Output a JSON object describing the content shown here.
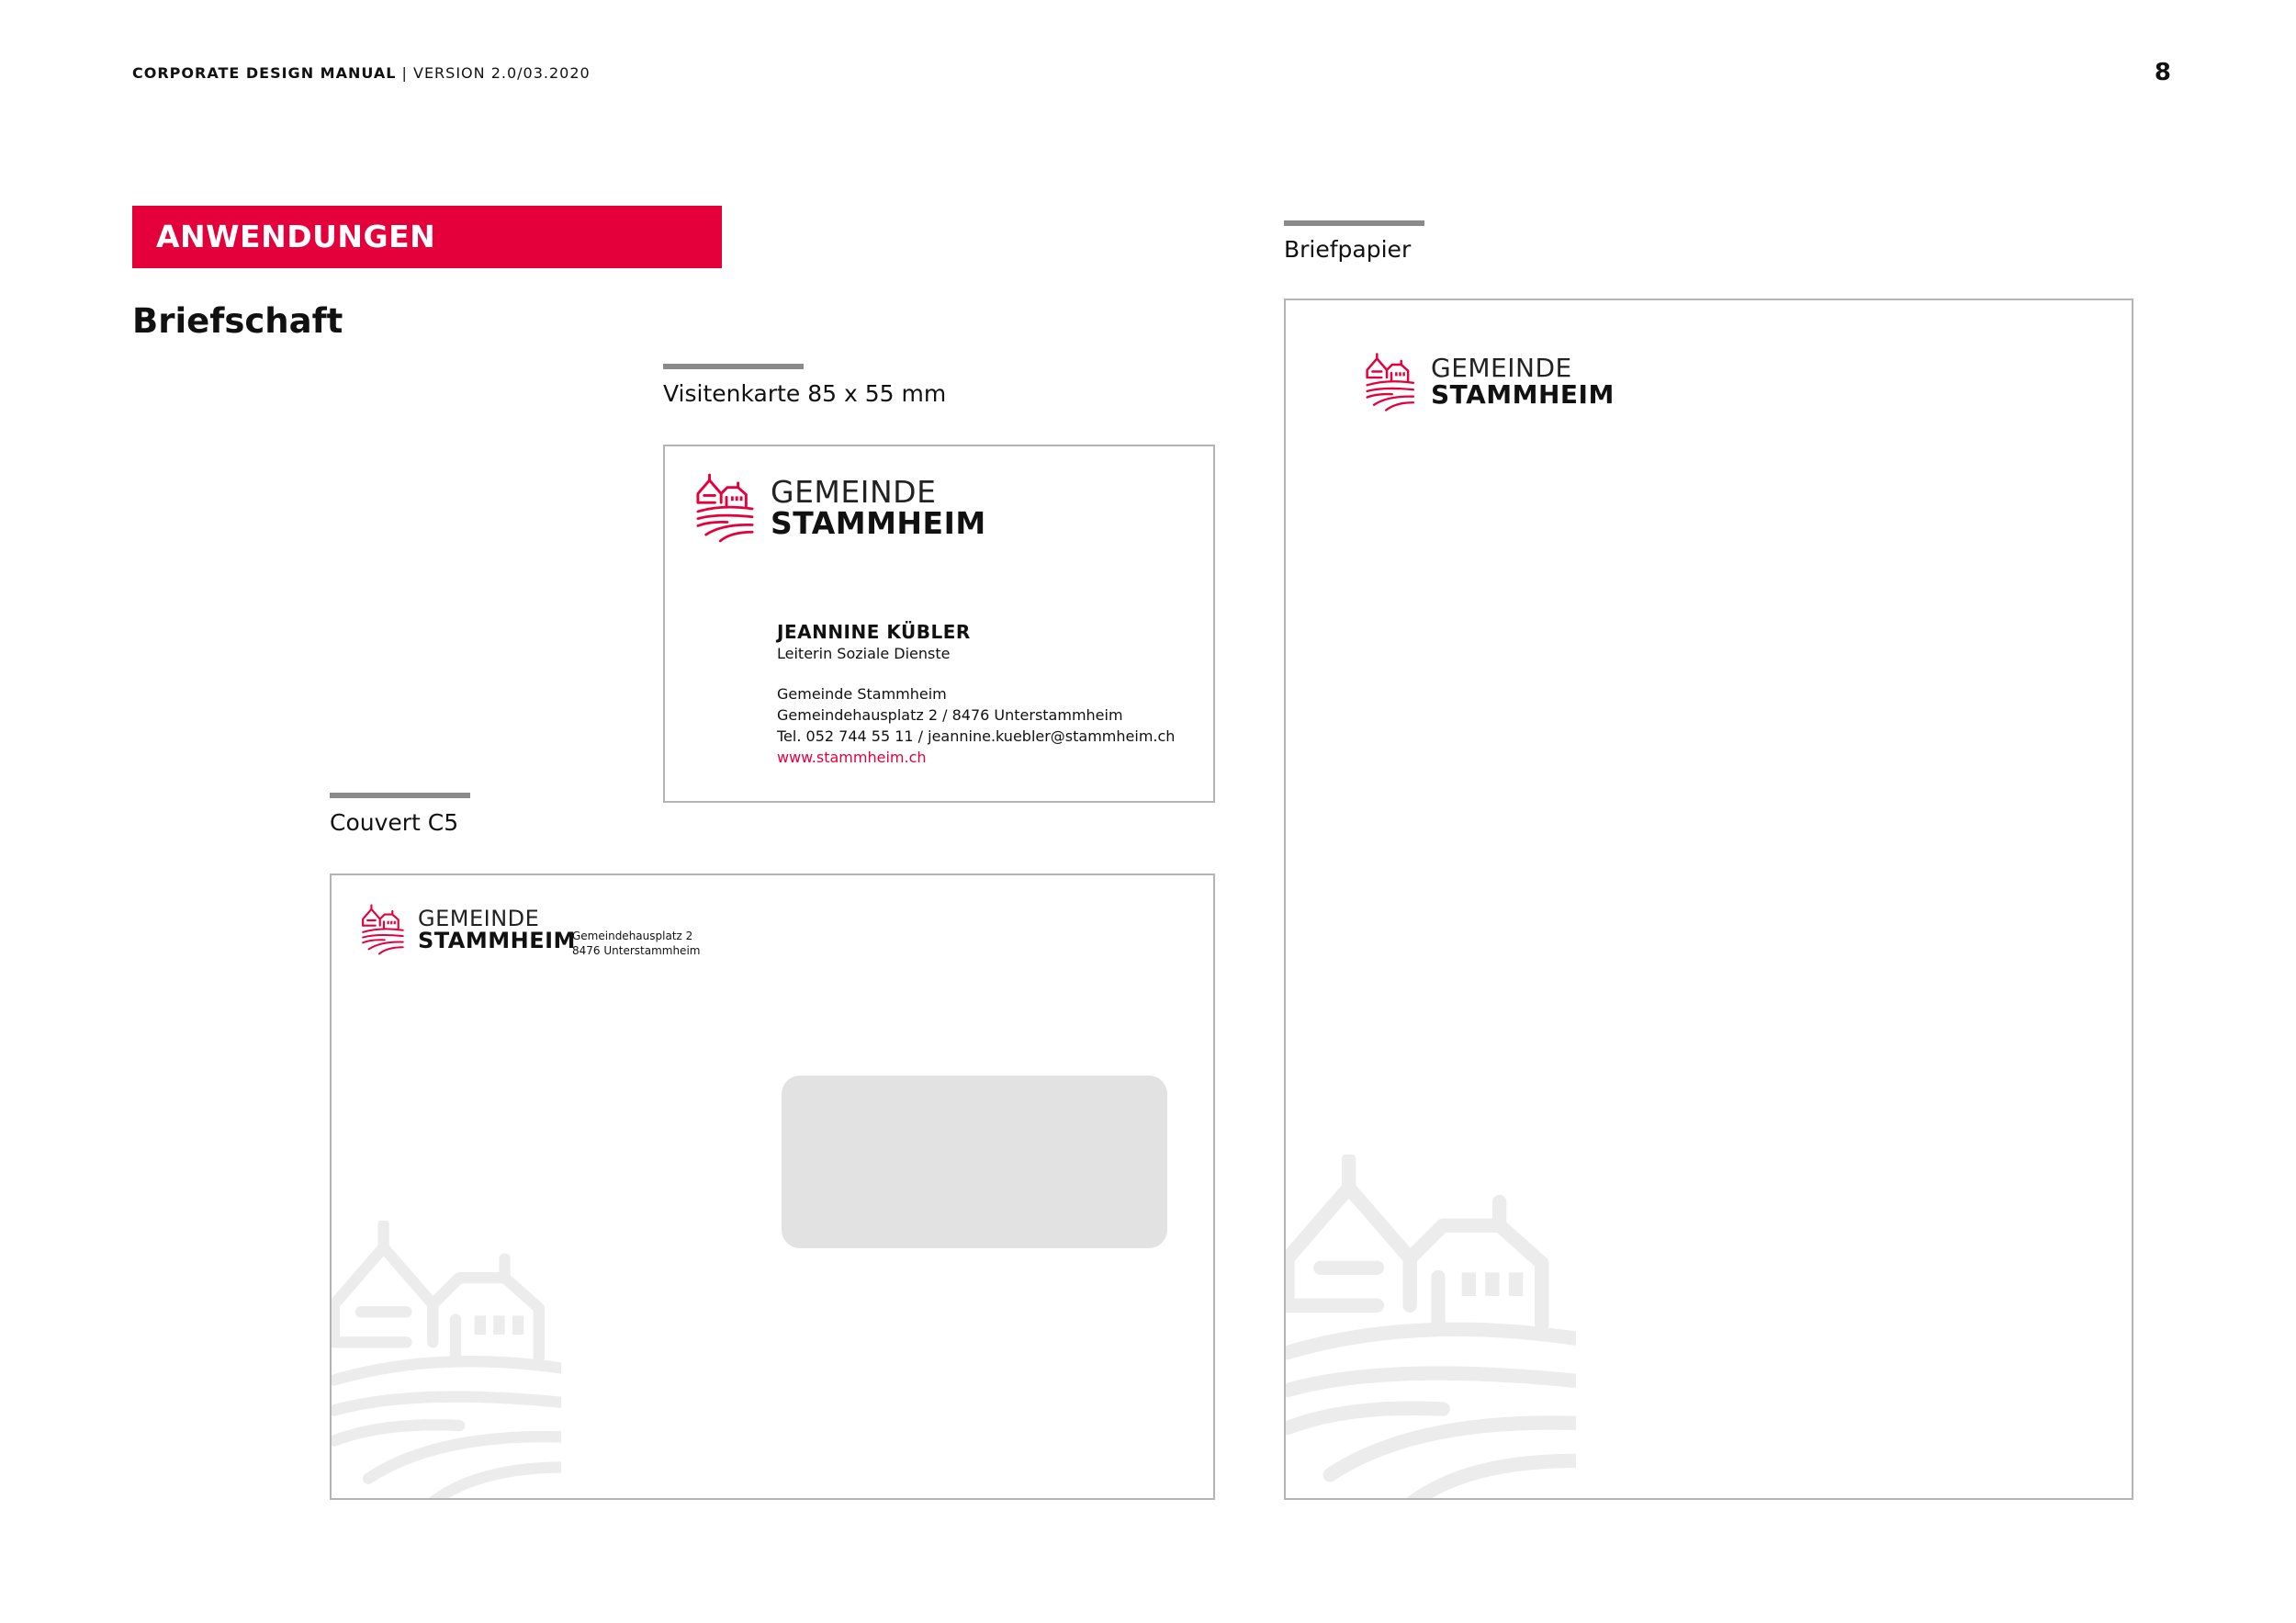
{
  "header": {
    "manual_title": "CORPORATE DESIGN MANUAL",
    "version": "| VERSION 2.0/03.2020",
    "page_number": "8"
  },
  "section": {
    "banner": "ANWENDUNGEN",
    "subtitle": "Briefschaft"
  },
  "logo": {
    "line1": "GEMEINDE",
    "line2": "STAMMHEIM",
    "icon": "castle-vineyard-icon",
    "color": "#e4003a"
  },
  "business_card": {
    "caption": "Visitenkarte 85 x 55 mm",
    "name": "JEANNINE KÜBLER",
    "role": "Leiterin Soziale Dienste",
    "org": "Gemeinde Stammheim",
    "address": "Gemeindehausplatz 2 / 8476 Unterstammheim",
    "contact": "Tel. 052 744 55 11 / jeannine.kuebler@stammheim.ch",
    "website": "www.stammheim.ch"
  },
  "envelope": {
    "caption": "Couvert C5",
    "address_line1": "Gemeindehausplatz 2",
    "address_line2": "8476 Unterstammheim"
  },
  "letterhead": {
    "caption": "Briefpapier"
  },
  "colors": {
    "brand_red": "#e4003a",
    "rule_gray": "#8a8a8a",
    "window_gray": "#e2e2e2"
  }
}
